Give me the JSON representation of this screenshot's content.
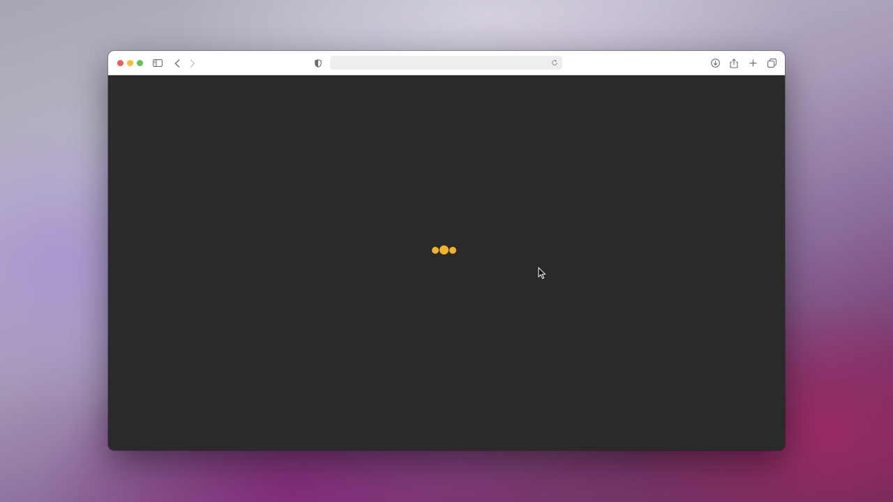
{
  "browser": {
    "address_bar": {
      "value": "",
      "placeholder": ""
    },
    "icons": {
      "sidebar": "sidebar-icon",
      "back": "chevron-left-icon",
      "forward": "chevron-right-icon",
      "privacy": "shield-icon",
      "reload": "reload-icon",
      "download": "download-icon",
      "share": "share-icon",
      "new_tab": "plus-icon",
      "tab_overview": "tabs-icon"
    }
  },
  "page": {
    "state": "loading",
    "loader_color": "#f2b52a",
    "background_color": "#2a2a2a"
  }
}
